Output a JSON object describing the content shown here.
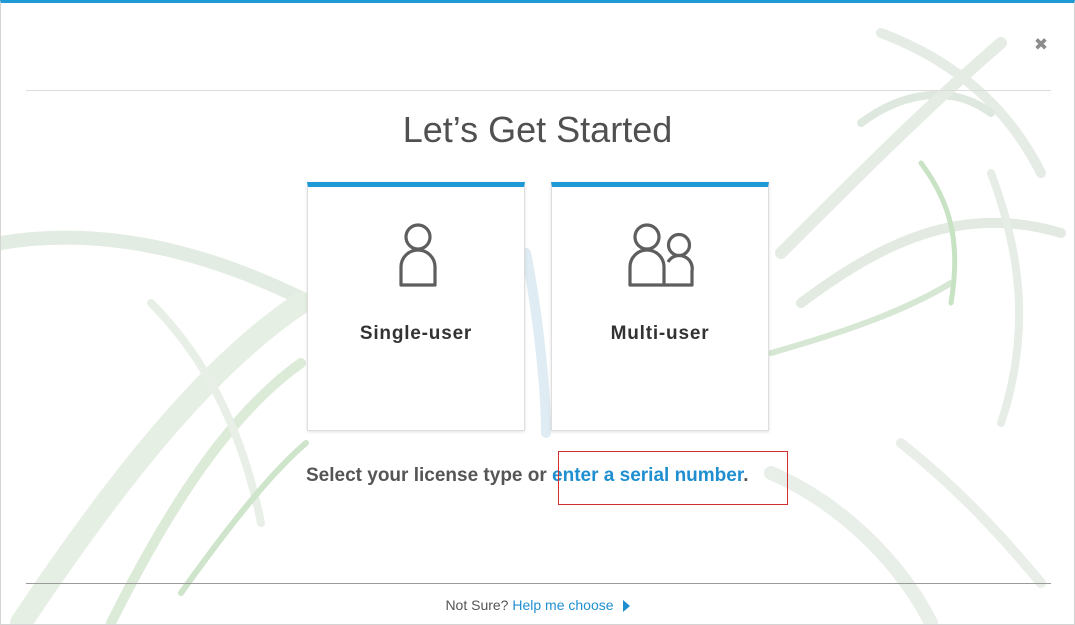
{
  "dialog": {
    "title": "Let’s Get Started",
    "close_symbol": "✖",
    "cards": [
      {
        "label": "Single-user",
        "icon": "single-user-icon"
      },
      {
        "label": "Multi-user",
        "icon": "multi-user-icon"
      }
    ],
    "prompt_text": "Select your license type or",
    "serial_link": "enter a serial number",
    "prompt_end": ".",
    "footer": {
      "question": "Not Sure?",
      "help_link": "Help me choose"
    }
  },
  "colors": {
    "accent": "#1f9ad6",
    "link": "#1f8fd0",
    "highlight_border": "#d32f2f"
  }
}
